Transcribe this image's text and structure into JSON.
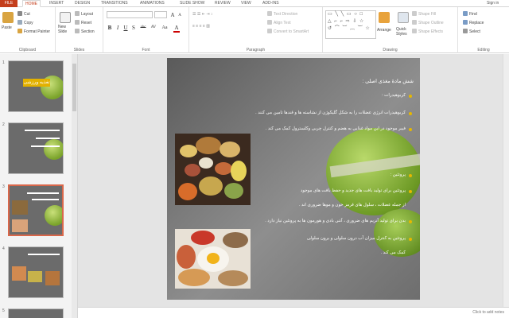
{
  "tabs": {
    "file": "FILE",
    "items": [
      "HOME",
      "INSERT",
      "DESIGN",
      "TRANSITIONS",
      "ANIMATIONS",
      "SLIDE SHOW",
      "REVIEW",
      "VIEW",
      "ADD-INS"
    ],
    "sign_in": "Sign in"
  },
  "ribbon": {
    "clipboard": {
      "paste": "Paste",
      "cut": "Cut",
      "copy": "Copy",
      "format_painter": "Format Painter",
      "label": "Clipboard"
    },
    "slides": {
      "new_slide": "New Slide",
      "layout": "Layout",
      "reset": "Reset",
      "section": "Section",
      "label": "Slides"
    },
    "font": {
      "label": "Font",
      "bold": "B",
      "italic": "I",
      "underline": "U",
      "shadow": "S",
      "strike": "abc",
      "spacing": "AV",
      "case": "Aa",
      "color": "A"
    },
    "paragraph": {
      "label": "Paragraph",
      "text_direction": "Text Direction",
      "align_text": "Align Text",
      "convert": "Convert to SmartArt"
    },
    "drawing": {
      "label": "Drawing",
      "arrange": "Arrange",
      "quick_styles": "Quick Styles",
      "shape_fill": "Shape Fill",
      "shape_outline": "Shape Outline",
      "shape_effects": "Shape Effects"
    },
    "editing": {
      "label": "Editing",
      "find": "Find",
      "replace": "Replace",
      "select": "Select"
    }
  },
  "thumbnails": {
    "numbers": [
      "1",
      "2",
      "3",
      "4",
      "5"
    ],
    "slide1_title": "تغذیه ورزشی"
  },
  "slide": {
    "title": "شش مادهٔ مغذی اصلی :",
    "lines": [
      "کربوهیدرات :",
      "کربوهیدرات انرژی عضلات را به شکل گلیکوژن از نشاسته ها و قندها تامین می کنند .",
      "فیبر موجود در این مواد غذایی به هضم و کنترل چربی وکلسترول کمک می کند .",
      "پروتئین :",
      "پروتئین برای تولید بافت های جدید و حفظ بافت های موجود",
      "از جمله عضلات ، سلول های قرمز خون و موها ضروری اند .",
      "بدن برای تولید آنزیم های ضروری ، آنتی بادی و هورمون ها به پروتئین نیاز دارد .",
      "پروتئین به کنترل میزان آب درون سلولی و برون سلولی",
      "کمک می کند ."
    ]
  },
  "notes_placeholder": "Click to add notes",
  "colors": {
    "file_tab": "#c43e1c",
    "accent_bullet": "#e6b800",
    "selection": "#d9674a"
  }
}
